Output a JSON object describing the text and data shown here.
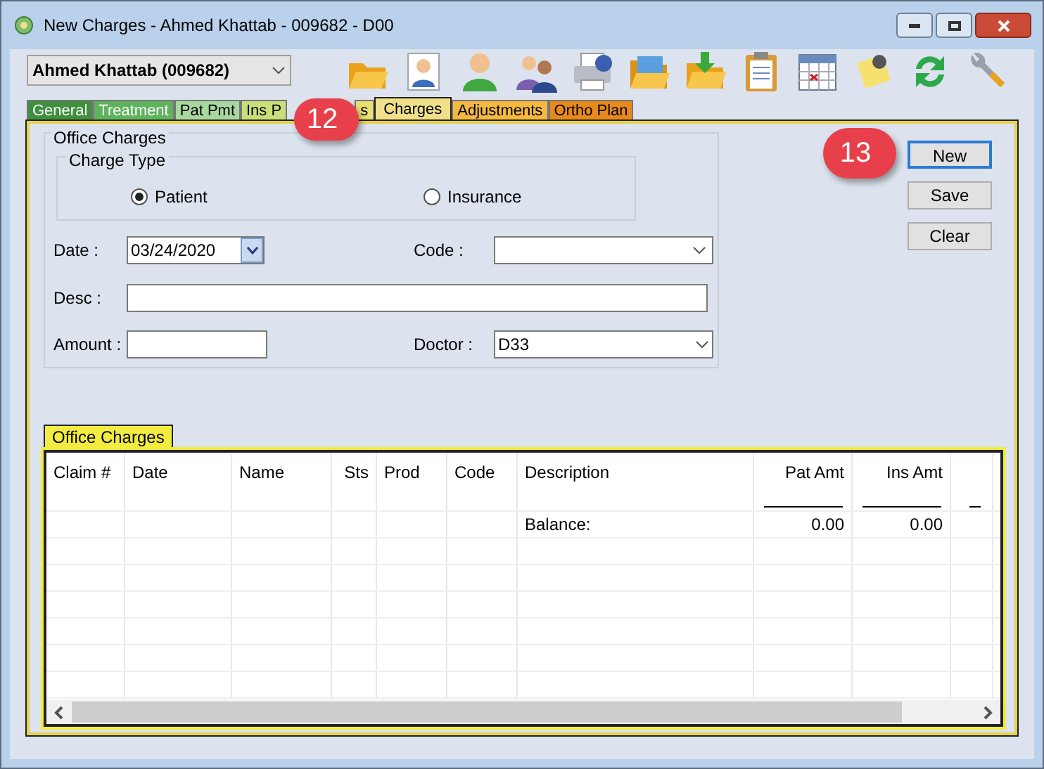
{
  "window": {
    "title": "New Charges - Ahmed Khattab - 009682 - D00"
  },
  "patient_select": {
    "value": "Ahmed Khattab (009682)"
  },
  "tabs": [
    {
      "label": "General",
      "selected": false,
      "color": "#3f8f3f"
    },
    {
      "label": "Treatment",
      "selected": false,
      "color": "#5fb35f"
    },
    {
      "label": "Pat Pmt",
      "selected": false,
      "color": "#a8d8a0"
    },
    {
      "label": "Ins P",
      "selected": false,
      "color": "#c8e07a"
    },
    {
      "label": "s",
      "selected": false,
      "color": "#e8e070"
    },
    {
      "label": "Charges",
      "selected": true,
      "color": "#f0e08a"
    },
    {
      "label": "Adjustments",
      "selected": false,
      "color": "#f5b840"
    },
    {
      "label": "Ortho Plan",
      "selected": false,
      "color": "#e8891c"
    }
  ],
  "form": {
    "group_title": "Office Charges",
    "charge_type": {
      "title": "Charge Type",
      "options": [
        {
          "label": "Patient",
          "selected": true
        },
        {
          "label": "Insurance",
          "selected": false
        }
      ]
    },
    "date": {
      "label": "Date :",
      "value": "03/24/2020"
    },
    "code": {
      "label": "Code :"
    },
    "desc": {
      "label": "Desc :"
    },
    "amount": {
      "label": "Amount :"
    },
    "doctor": {
      "label": "Doctor :",
      "value": "D33"
    }
  },
  "buttons": [
    "New",
    "Save",
    "Clear"
  ],
  "grid": {
    "tab": "Office Charges",
    "columns": [
      "Claim #",
      "Date",
      "Name",
      "Sts",
      "Prod",
      "Code",
      "Description",
      "Pat Amt",
      "Ins Amt"
    ],
    "rows": [
      {
        "cells": [
          "",
          "",
          "",
          "",
          "",
          "",
          "Balance:",
          "0.00",
          "0.00"
        ]
      }
    ]
  },
  "callouts": [
    {
      "text": "12"
    },
    {
      "text": "13"
    }
  ]
}
